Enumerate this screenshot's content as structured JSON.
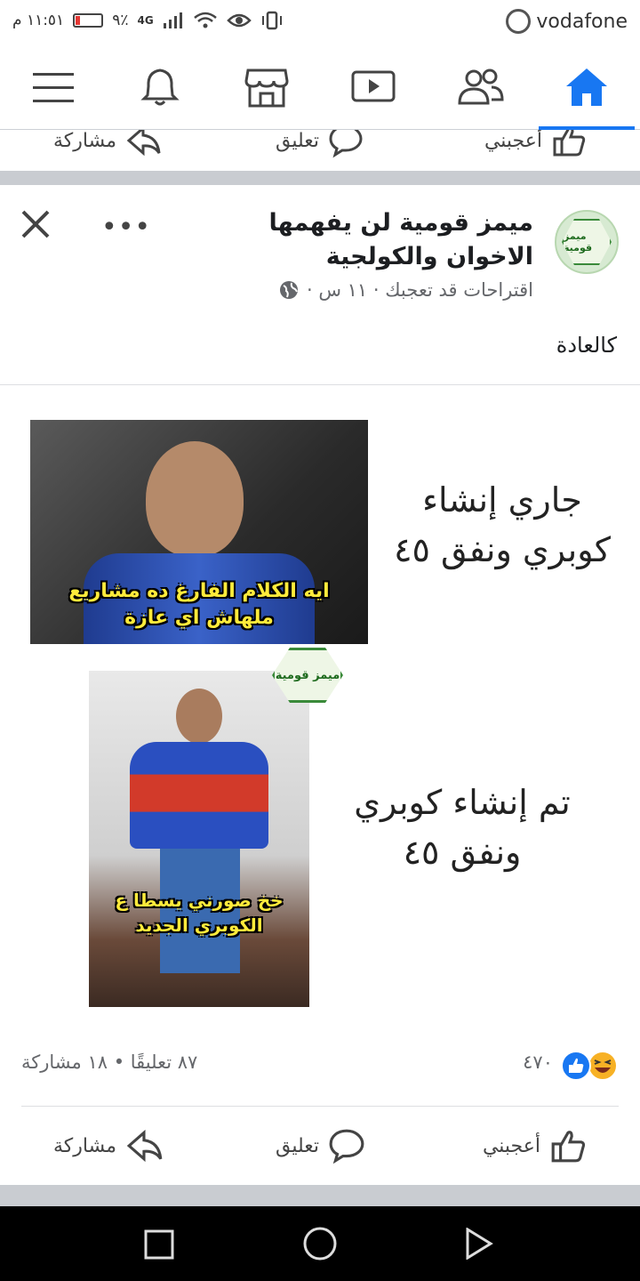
{
  "status_bar": {
    "carrier": "vodafone",
    "time": "١١:٥١ م",
    "battery": "٩٪",
    "network": "4G"
  },
  "nav": {
    "items": [
      "home",
      "friends",
      "watch",
      "marketplace",
      "notifications",
      "menu"
    ]
  },
  "previous_post": {
    "like_label": "أعجبني",
    "comment_label": "تعليق",
    "share_label": "مشاركة"
  },
  "post": {
    "page_name": "ميمز قومية لن يفهمها الاخوان والكولجية",
    "meta": "اقتراحات قد تعجبك · ١١ س ·",
    "text": "كالعادة",
    "avatar_text": "ميمز قومية",
    "image": {
      "top_caption": "جاري إنشاء كوبري ونفق ٤٥",
      "top_photo_caption": "ايه الكلام الفارغ ده مشاريع ملهاش اي عازة",
      "bottom_caption": "تم إنشاء كوبري ونفق ٤٥",
      "bottom_photo_caption": "خخ صورني يسطا ع الكوبري الجديد",
      "badge_text": "ميمز قومية"
    },
    "reactions_count": "٤٧٠",
    "stats": "٨٧ تعليقًا • ١٨ مشاركة",
    "like_label": "أعجبني",
    "comment_label": "تعليق",
    "share_label": "مشاركة"
  },
  "colors": {
    "accent": "#1877f2",
    "haha": "#f7b125",
    "separator": "#c9ccd1"
  }
}
